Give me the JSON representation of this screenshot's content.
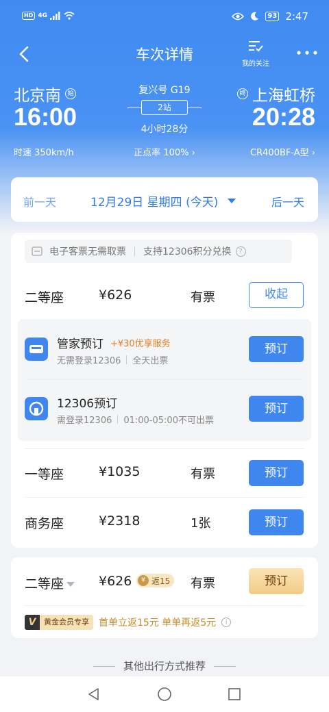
{
  "status_bar": {
    "hd": "HD",
    "network": "4G",
    "battery": "93",
    "time": "2:47"
  },
  "nav": {
    "title": "车次详情",
    "follow_label": "我的关注"
  },
  "train": {
    "from_station": "北京南",
    "from_mark": "始",
    "to_station": "上海虹桥",
    "to_mark": "终",
    "dep_time": "16:00",
    "arr_time": "20:28",
    "train_no": "复兴号 G19",
    "stops": "2站",
    "duration": "4小时28分",
    "speed": "时速 350km/h",
    "on_time": "正点率 100% ›",
    "model": "CR400BF-A型 ›"
  },
  "date_bar": {
    "prev": "前一天",
    "current": "12月29日 星期四 (今天)",
    "next": "后一天"
  },
  "notice": {
    "text1": "电子客票无需取票",
    "text2": "支持12306积分兑换",
    "help": "?"
  },
  "seats": [
    {
      "name": "二等座",
      "price": "¥626",
      "availability": "有票",
      "action": "收起"
    },
    {
      "name": "一等座",
      "price": "¥1035",
      "availability": "有票",
      "action": "预订"
    },
    {
      "name": "商务座",
      "price": "¥2318",
      "availability": "1张",
      "action": "预订"
    }
  ],
  "booking_options": [
    {
      "title": "管家预订",
      "promo": "+¥30优享服务",
      "sub1": "无需登录12306",
      "sub2": "全天出票",
      "action": "预订"
    },
    {
      "title": "12306预订",
      "promo": "",
      "sub1": "需登录12306",
      "sub2": "01:00-05:00不可出票",
      "action": "预订"
    }
  ],
  "vip": {
    "seat": "二等座",
    "price": "¥626",
    "cashback_badge": "返15",
    "availability": "有票",
    "action": "预订",
    "tag_v": "V",
    "tag": "黄金会员专享",
    "text": "首单立返15元 单单再返5元"
  },
  "more_title": "其他出行方式推荐",
  "colors": {
    "primary": "#3f87ef",
    "gold": "#f1cb8a",
    "promo": "#e67e22"
  }
}
